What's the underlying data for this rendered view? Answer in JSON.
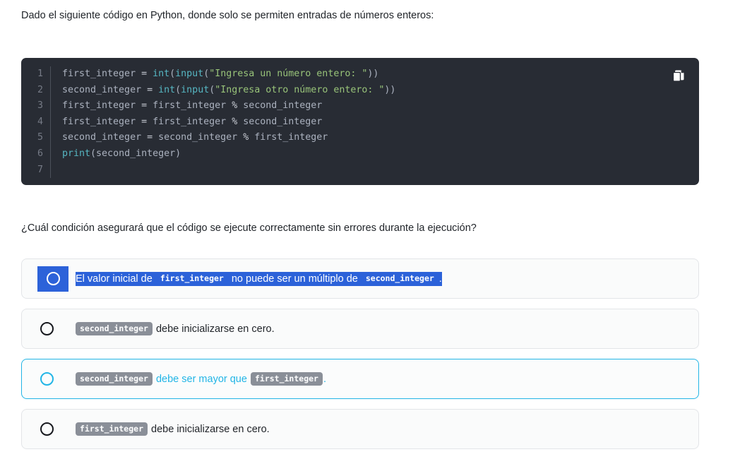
{
  "intro": "Dado el siguiente código en Python, donde solo se permiten entradas de números enteros:",
  "code": {
    "line_numbers": [
      "1",
      "2",
      "3",
      "4",
      "5",
      "6",
      "7"
    ],
    "lines": [
      "first_integer = int(input(\"Ingresa un número entero: \"))",
      "second_integer = int(input(\"Ingresa otro número entero: \"))",
      "first_integer = first_integer % second_integer",
      "first_integer = first_integer % second_integer",
      "second_integer = second_integer % first_integer",
      "print(second_integer)",
      ""
    ],
    "copy_label": "copy-icon",
    "background": "#282c34",
    "string_color": "#98c379",
    "function_color": "#56b6c2",
    "text_color": "#abb2bf",
    "gutter_color": "#757a85"
  },
  "question": "¿Cuál condición asegurará que el código se ejecute correctamente sin errores durante la ejecución?",
  "options": [
    {
      "parts": [
        {
          "type": "text",
          "value": "El valor inicial de "
        },
        {
          "type": "code",
          "value": "first_integer"
        },
        {
          "type": "text",
          "value": " no puede ser un múltiplo de "
        },
        {
          "type": "code",
          "value": "second_integer"
        },
        {
          "type": "text",
          "value": "."
        }
      ],
      "state": "text-selected",
      "selection_color": "#2c62d9"
    },
    {
      "parts": [
        {
          "type": "code",
          "value": "second_integer"
        },
        {
          "type": "text",
          "value": " debe inicializarse en cero."
        }
      ],
      "state": "normal"
    },
    {
      "parts": [
        {
          "type": "code",
          "value": "second_integer"
        },
        {
          "type": "text",
          "value": " debe ser mayor que "
        },
        {
          "type": "code",
          "value": "first_integer"
        },
        {
          "type": "text",
          "value": "."
        }
      ],
      "state": "selected",
      "accent_color": "#22b5e6"
    },
    {
      "parts": [
        {
          "type": "code",
          "value": "first_integer"
        },
        {
          "type": "text",
          "value": " debe inicializarse en cero."
        }
      ],
      "state": "normal"
    }
  ]
}
